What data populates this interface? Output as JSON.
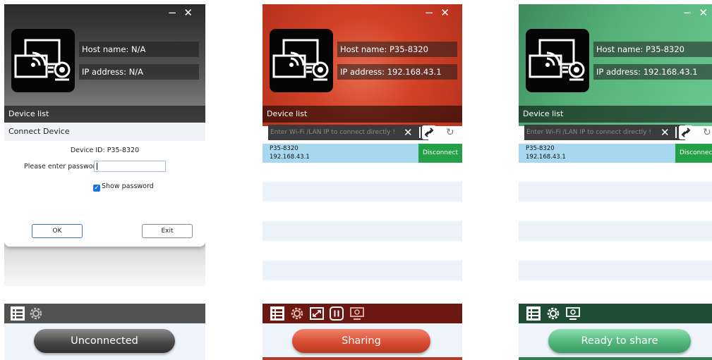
{
  "window": {
    "minimize_glyph": "−",
    "close_glyph": "✕"
  },
  "panels": [
    {
      "host": "Host name:  N/A",
      "ip": "IP address:  N/A",
      "device_list": "Device list",
      "dialog": {
        "title": "Connect Device",
        "device_id": "Device ID: P35-8320",
        "password_label": "Please enter password:",
        "show_password": "Show password",
        "ok": "OK",
        "exit": "Exit"
      },
      "status_button": "Unconnected"
    },
    {
      "host": "Host name: P35-8320",
      "ip": "IP address: 192.168.43.1",
      "device_list": "Device list",
      "search_placeholder": "Enter Wi-Fi /LAN IP to connect directly !",
      "device": {
        "name": "P35-8320",
        "ip": "192.168.43.1",
        "action": "Disconnect"
      },
      "status_button": "Sharing"
    },
    {
      "host": "Host name: P35-8320",
      "ip": "IP address: 192.168.43.1",
      "device_list": "Device list",
      "search_placeholder": "Enter Wi-Fi /LAN IP to connect directly !",
      "device": {
        "name": "P35-8320",
        "ip": "192.168.43.1",
        "action": "Disconnect"
      },
      "status_button": "Ready to share"
    }
  ],
  "colors": {
    "sharing": "#d94d33",
    "ready": "#51b57c",
    "unconnected": "#4a4a4a",
    "selected_row": "#a8d7f0",
    "disconnect": "#24a148"
  }
}
